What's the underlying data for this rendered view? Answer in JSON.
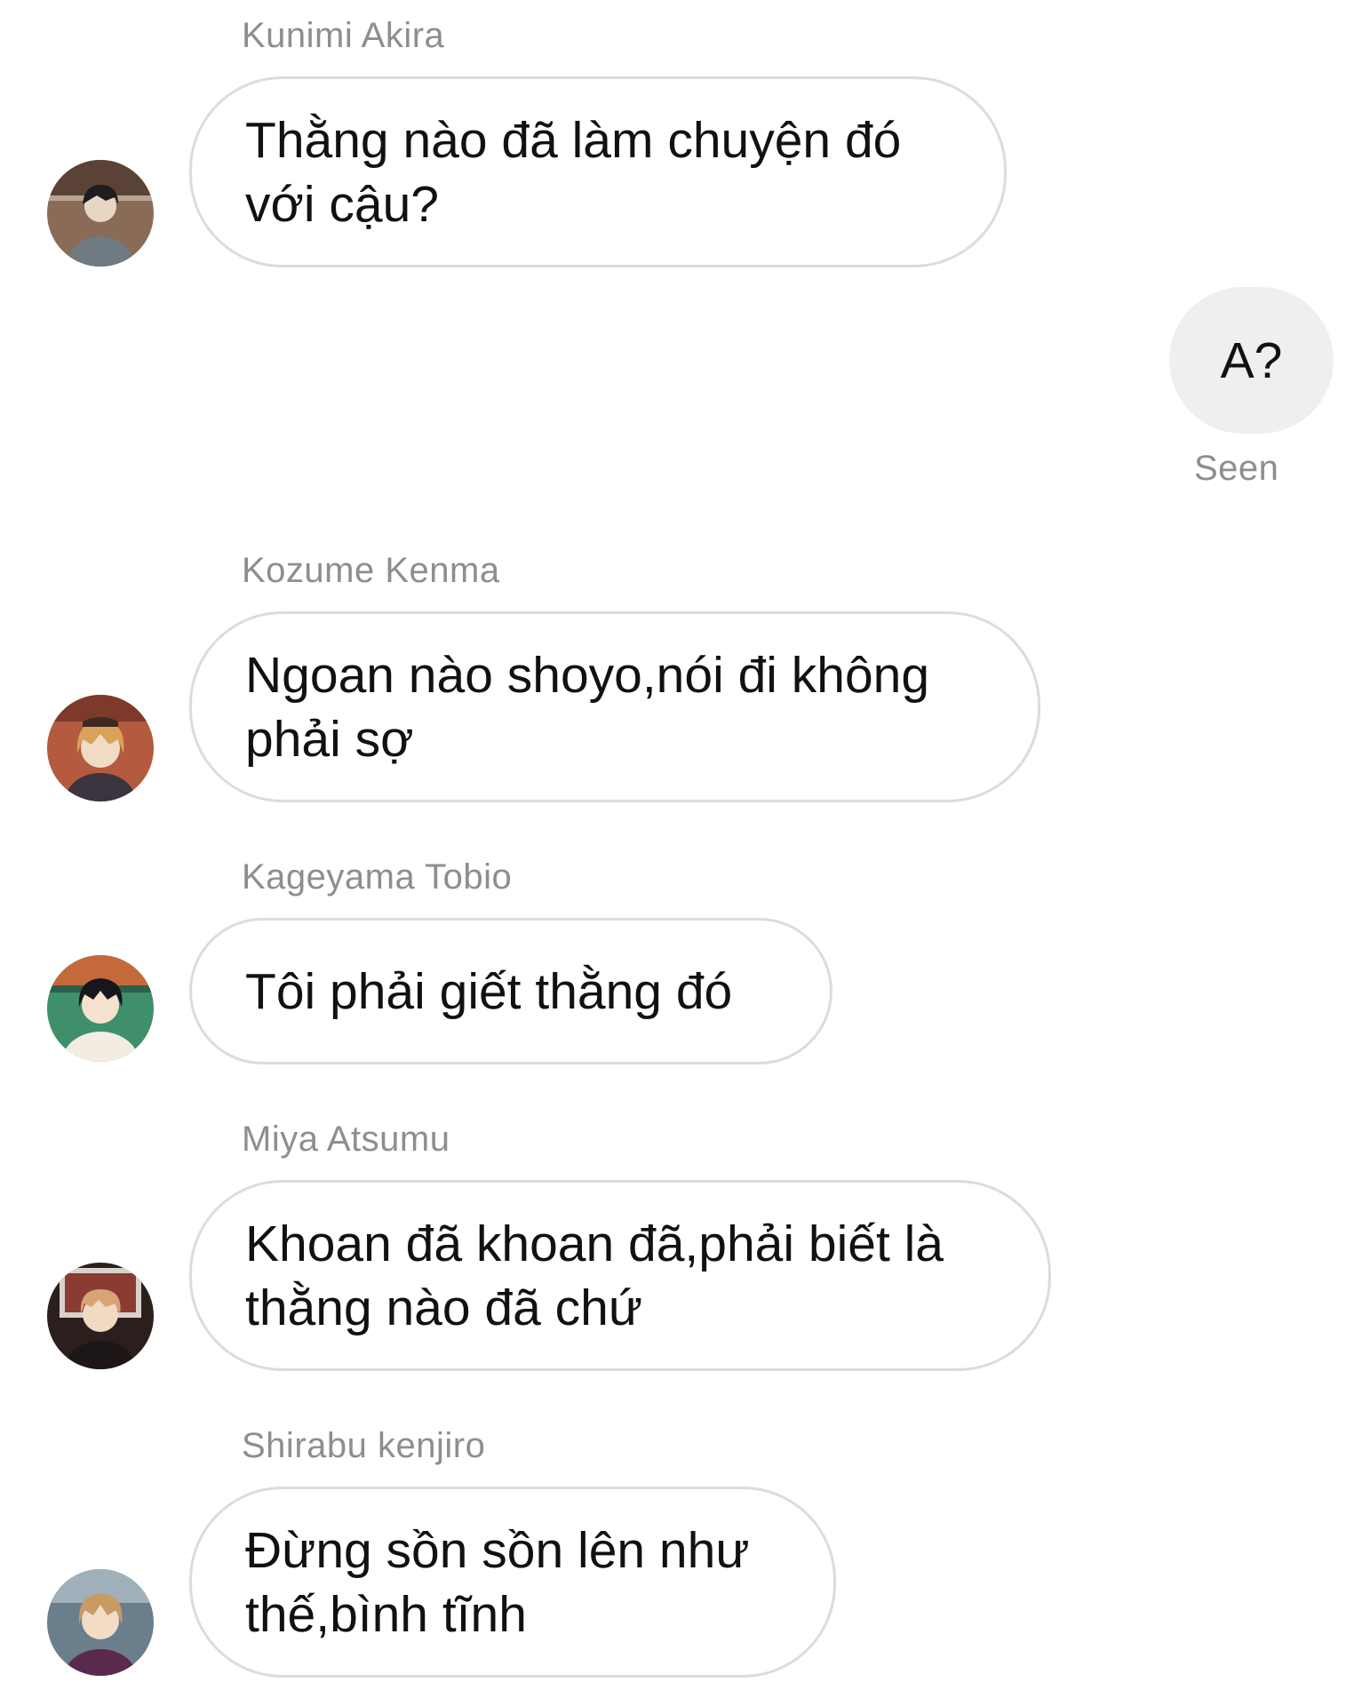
{
  "messages": [
    {
      "sender": "Kunimi Akira",
      "text": "Thằng nào đã làm chuyện đó\nvới cậu?",
      "avatar": "avatar-kunimi"
    },
    {
      "sender": "Kozume Kenma",
      "text": "Ngoan nào shoyo,nói đi không\nphải sợ",
      "avatar": "avatar-kenma"
    },
    {
      "sender": "Kageyama Tobio",
      "text": "Tôi phải giết thằng đó",
      "avatar": "avatar-kageyama"
    },
    {
      "sender": "Miya Atsumu",
      "text": "Khoan đã khoan đã,phải biết là\nthằng nào đã chứ",
      "avatar": "avatar-atsumu"
    },
    {
      "sender": "Shirabu kenjiro",
      "text": "Đừng sồn sồn lên như\nthế,bình tĩnh",
      "avatar": "avatar-shirabu"
    }
  ],
  "own_message": {
    "text": "A?",
    "status": "Seen"
  },
  "colors": {
    "bubble_border": "#dcdcdc",
    "own_bubble_bg": "#efefef",
    "meta_text": "#8e8e8e",
    "message_text": "#111111"
  }
}
